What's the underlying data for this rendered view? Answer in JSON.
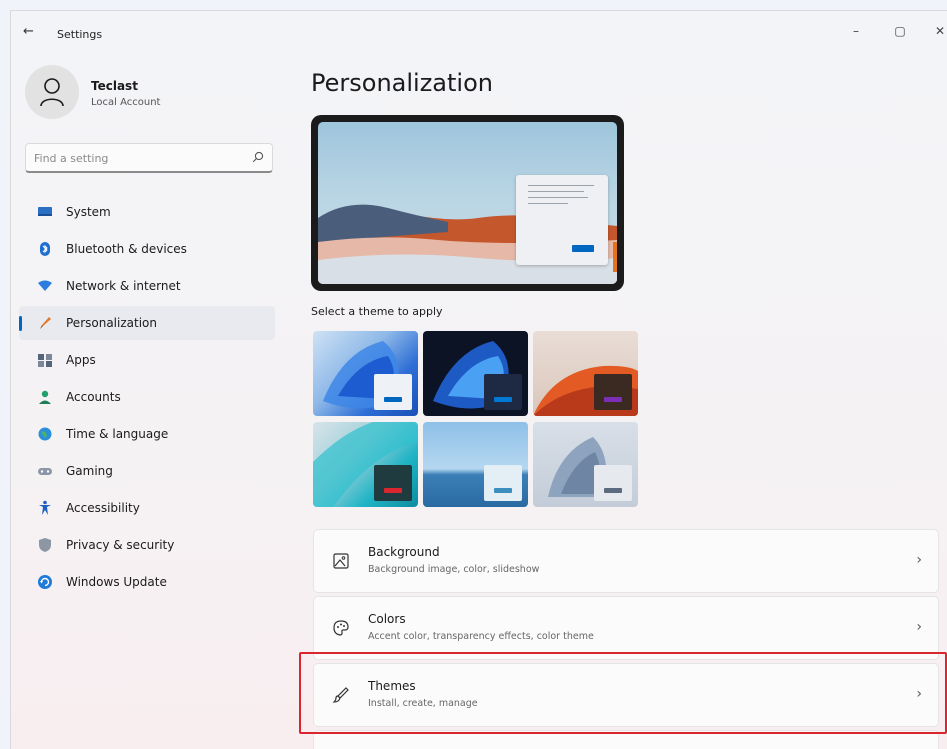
{
  "titlebar": {
    "back_glyph": "←",
    "title": "Settings",
    "minimize_glyph": "–",
    "maximize_glyph": "▢",
    "close_glyph": "✕"
  },
  "account": {
    "name": "Teclast",
    "type": "Local Account"
  },
  "search": {
    "placeholder": "Find a setting",
    "icon": "search-icon"
  },
  "nav": {
    "items": [
      {
        "label": "System",
        "icon": "system-icon"
      },
      {
        "label": "Bluetooth & devices",
        "icon": "bluetooth-icon"
      },
      {
        "label": "Network & internet",
        "icon": "network-icon"
      },
      {
        "label": "Personalization",
        "icon": "personalization-icon",
        "active": true
      },
      {
        "label": "Apps",
        "icon": "apps-icon"
      },
      {
        "label": "Accounts",
        "icon": "accounts-icon"
      },
      {
        "label": "Time & language",
        "icon": "globe-icon"
      },
      {
        "label": "Gaming",
        "icon": "gamepad-icon"
      },
      {
        "label": "Accessibility",
        "icon": "accessibility-icon"
      },
      {
        "label": "Privacy & security",
        "icon": "shield-icon"
      },
      {
        "label": "Windows Update",
        "icon": "update-icon"
      }
    ]
  },
  "main": {
    "title": "Personalization",
    "theme_heading": "Select a theme to apply",
    "themes": [
      {
        "name": "windows-light",
        "accent": "#0067c0"
      },
      {
        "name": "windows-dark",
        "accent": "#0078d4"
      },
      {
        "name": "glow",
        "accent": "#7a2fb5"
      },
      {
        "name": "captured-motion",
        "accent": "#d9262f"
      },
      {
        "name": "sunrise",
        "accent": "#3a8fbf"
      },
      {
        "name": "flow",
        "accent": "#5a6b80"
      }
    ],
    "cards": [
      {
        "title": "Background",
        "subtitle": "Background image, color, slideshow",
        "icon": "image-icon"
      },
      {
        "title": "Colors",
        "subtitle": "Accent color, transparency effects, color theme",
        "icon": "palette-icon"
      },
      {
        "title": "Themes",
        "subtitle": "Install, create, manage",
        "icon": "brush-icon"
      }
    ],
    "chevron_glyph": "›"
  },
  "colors": {
    "accent": "#0067c0",
    "highlight": "#d9262f"
  }
}
